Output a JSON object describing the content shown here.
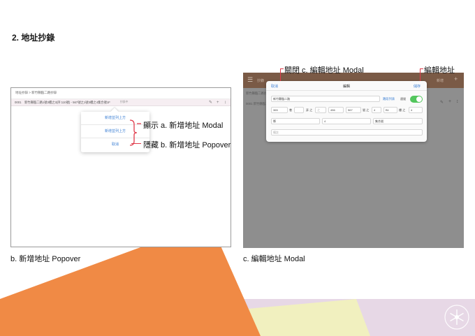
{
  "section_title": "2. 地址抄錄",
  "panel_b": {
    "caption": "b. 新增地址 Popover",
    "breadcrumb": "地址抄錄 > 新竹縣臨二路抄錄",
    "bar_no": "0001",
    "bar_address": "新竹縣臨二路1號3樓之3(序:110號) - 567號之1號3樓之4集合號1F",
    "bar_status": "抄錄中",
    "popover": {
      "items": [
        "新增並列上方",
        "新增並列上方",
        "取消"
      ]
    },
    "callouts": {
      "show_modal": "顯示 a. 新增地址 Modal",
      "hide_popover": "隱藏 b. 新增地址 Popover"
    }
  },
  "panel_c": {
    "caption": "c. 編輯地址 Modal",
    "app_title": "抄錄",
    "topbar_right": "新增",
    "sub_line": "新竹縣臨二路抄錄",
    "sub_line2": "0001   新竹縣臨二路",
    "modal": {
      "cancel": "取消",
      "title": "編輯",
      "save": "儲存",
      "road": "新竹縣臨二路",
      "road_link": "路段列表",
      "toggle_label": "連號",
      "row2": [
        {
          "label": "",
          "value": "365"
        },
        {
          "label": "巷",
          "value": ""
        },
        {
          "label": "弄 之",
          "value": "之"
        },
        {
          "label": "",
          "value": "456"
        },
        {
          "label": "",
          "value": "567"
        },
        {
          "label": "號 之",
          "value": "4"
        },
        {
          "label": "",
          "value": "B1"
        },
        {
          "label": "樓 之",
          "value": "4"
        }
      ],
      "row3": [
        "鄰",
        "4",
        "集合號"
      ],
      "note": "備註"
    },
    "callouts": {
      "close_modal": "關閉 c. 編輯地址 Modal",
      "edit_address": "編輯地址"
    }
  },
  "colors": {
    "accent_blue": "#3b7fd4",
    "callout_red": "#e03a4a",
    "toggle_green": "#53c65d",
    "orange": "#f08a45",
    "teal": "#cfe6e2",
    "lavender": "#e7d8e6",
    "pale_yellow": "#f1f0bf"
  },
  "icons": {
    "edit": "edit-icon",
    "add": "plus-icon",
    "expand": "expand-icon",
    "menu": "hamburger-icon",
    "logo": "snowflake-logo-icon"
  }
}
